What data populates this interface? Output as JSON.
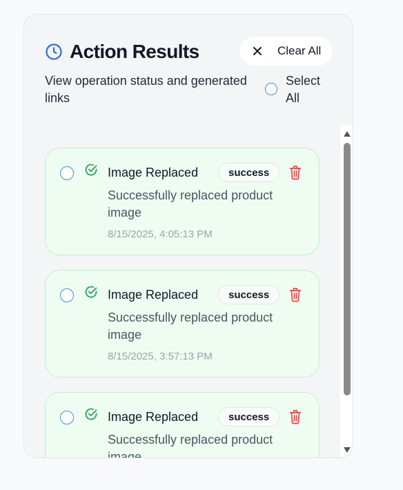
{
  "header": {
    "title": "Action Results",
    "subtitle": "View operation status and generated links",
    "clear_all_label": "Clear All",
    "select_all_label": "Select All",
    "title_icon": "clock-icon"
  },
  "colors": {
    "accent_blue": "#2f6fd6",
    "success_green": "#22a55a",
    "delete_red": "#e04848",
    "card_bg": "#eefcf1",
    "card_border": "#c3ecd0"
  },
  "results": [
    {
      "title": "Image Replaced",
      "status": "success",
      "message": "Successfully replaced product image",
      "timestamp": "8/15/2025, 4:05:13 PM"
    },
    {
      "title": "Image Replaced",
      "status": "success",
      "message": "Successfully replaced product image",
      "timestamp": "8/15/2025, 3:57:13 PM"
    },
    {
      "title": "Image Replaced",
      "status": "success",
      "message": "Successfully replaced product image",
      "timestamp": ""
    }
  ]
}
